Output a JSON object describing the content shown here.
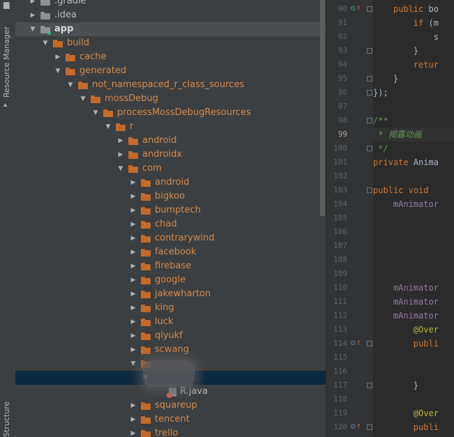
{
  "sidebar": {
    "resource_manager_label": "Resource Manager",
    "structure_label": "Structure"
  },
  "tree": {
    "rows": [
      {
        "label": ".gradle",
        "arrow": "▶",
        "folder": "grey",
        "style": "white"
      },
      {
        "label": ".idea",
        "arrow": "▶",
        "folder": "grey",
        "style": "white"
      },
      {
        "label": "app",
        "arrow": "▼",
        "folder": "grey",
        "style": "bold"
      },
      {
        "label": "build",
        "arrow": "▼",
        "folder": "orange",
        "style": "orange"
      },
      {
        "label": "cache",
        "arrow": "▶",
        "folder": "orange",
        "style": "orange"
      },
      {
        "label": "generated",
        "arrow": "▼",
        "folder": "orange",
        "style": "orange"
      },
      {
        "label": "not_namespaced_r_class_sources",
        "arrow": "▼",
        "folder": "orange",
        "style": "orange"
      },
      {
        "label": "mossDebug",
        "arrow": "▼",
        "folder": "orange",
        "style": "orange"
      },
      {
        "label": "processMossDebugResources",
        "arrow": "▼",
        "folder": "orange",
        "style": "orange"
      },
      {
        "label": "r",
        "arrow": "▼",
        "folder": "orange",
        "style": "orange"
      },
      {
        "label": "android",
        "arrow": "▶",
        "folder": "orange",
        "style": "orange"
      },
      {
        "label": "androidx",
        "arrow": "▶",
        "folder": "orange",
        "style": "orange"
      },
      {
        "label": "com",
        "arrow": "▼",
        "folder": "orange",
        "style": "orange"
      },
      {
        "label": "android",
        "arrow": "▶",
        "folder": "orange",
        "style": "orange"
      },
      {
        "label": "bigkoo",
        "arrow": "▶",
        "folder": "orange",
        "style": "orange"
      },
      {
        "label": "bumptech",
        "arrow": "▶",
        "folder": "orange",
        "style": "orange"
      },
      {
        "label": "chad",
        "arrow": "▶",
        "folder": "orange",
        "style": "orange"
      },
      {
        "label": "contrarywind",
        "arrow": "▶",
        "folder": "orange",
        "style": "orange"
      },
      {
        "label": "facebook",
        "arrow": "▶",
        "folder": "orange",
        "style": "orange"
      },
      {
        "label": "firebase",
        "arrow": "▶",
        "folder": "orange",
        "style": "orange"
      },
      {
        "label": "google",
        "arrow": "▶",
        "folder": "orange",
        "style": "orange"
      },
      {
        "label": "jakewharton",
        "arrow": "▶",
        "folder": "orange",
        "style": "orange"
      },
      {
        "label": "king",
        "arrow": "▶",
        "folder": "orange",
        "style": "orange"
      },
      {
        "label": "luck",
        "arrow": "▶",
        "folder": "orange",
        "style": "orange"
      },
      {
        "label": "qiyukf",
        "arrow": "▶",
        "folder": "orange",
        "style": "orange"
      },
      {
        "label": "scwang",
        "arrow": "▶",
        "folder": "orange",
        "style": "orange"
      },
      {
        "label": "",
        "arrow": "▼",
        "folder": "orange",
        "style": "orange"
      },
      {
        "label": "",
        "arrow": "▼",
        "folder": "none",
        "style": "orange"
      },
      {
        "label": "R.java",
        "arrow": "",
        "folder": "java",
        "style": "white"
      },
      {
        "label": "squareup",
        "arrow": "▶",
        "folder": "orange",
        "style": "orange"
      },
      {
        "label": "tencent",
        "arrow": "▶",
        "folder": "orange",
        "style": "orange"
      },
      {
        "label": "trello",
        "arrow": "▶",
        "folder": "orange",
        "style": "orange"
      }
    ]
  },
  "editor": {
    "line_numbers": [
      "90",
      "91",
      "92",
      "93",
      "94",
      "95",
      "96",
      "97",
      "98",
      "99",
      "100",
      "101",
      "102",
      "103",
      "104",
      "105",
      "106",
      "107",
      "108",
      "109",
      "110",
      "111",
      "112",
      "113",
      "114",
      "115",
      "116",
      "117",
      "118",
      "119",
      "120"
    ],
    "current_line": "99",
    "lines": [
      "    public bo",
      "        if (m",
      "            s",
      "        }",
      "        retur",
      "    }",
      "});",
      "",
      "/**",
      " * 揭露动画",
      " */",
      "private Anima",
      "",
      "public void ",
      "    mAnimator",
      "",
      "",
      "",
      "",
      "",
      "    mAnimator",
      "    mAnimator",
      "    mAnimator",
      "        @Over",
      "        publi",
      "            ",
      "            ",
      "        }",
      "",
      "        @Over",
      "        publi"
    ]
  },
  "colors": {
    "tree_bg": "#3c3f41",
    "selection": "#0d293e",
    "folder_orange": "#c46a2b",
    "editor_bg": "#2b2b2b",
    "keyword": "#cc7832",
    "comment": "#629755",
    "field": "#9876aa"
  }
}
